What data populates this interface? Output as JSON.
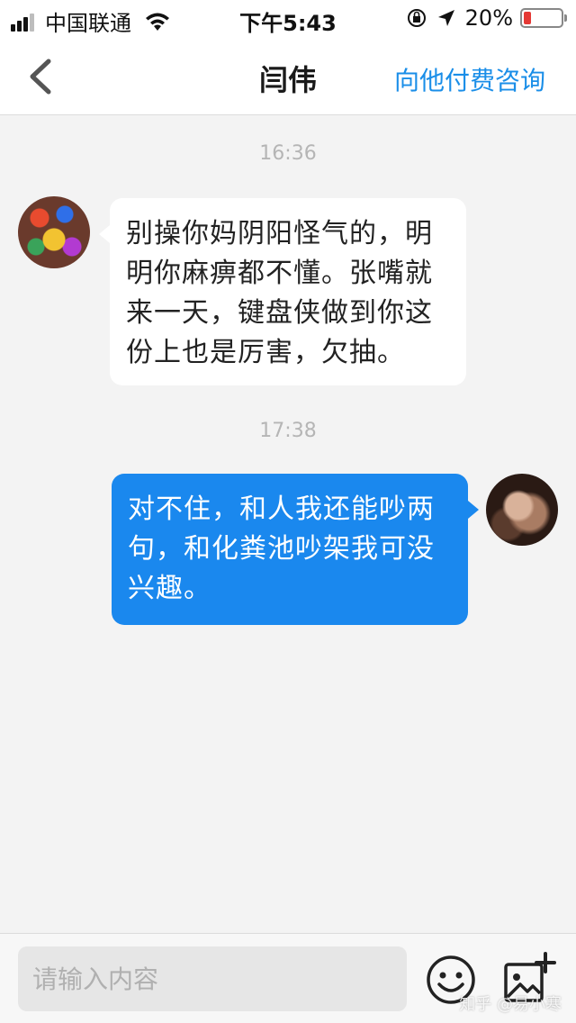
{
  "status_bar": {
    "carrier": "中国联通",
    "time": "下午5:43",
    "battery": "20%",
    "battery_level": 0.2
  },
  "nav": {
    "title": "闫伟",
    "action": "向他付费咨询"
  },
  "messages": [
    {
      "time": "16:36",
      "side": "left",
      "text": "别操你妈阴阳怪气的，明明你麻痹都不懂。张嘴就来一天，键盘侠做到你这份上也是厉害，欠抽。"
    },
    {
      "time": "17:38",
      "side": "right",
      "text": "对不住，和人我还能吵两句，和化粪池吵架我可没兴趣。"
    }
  ],
  "input": {
    "placeholder": "请输入内容"
  },
  "watermark": "知乎 @易小寒",
  "colors": {
    "accent": "#1a88ee",
    "battery_low": "#e53935"
  },
  "icons": [
    "signal-icon",
    "wifi-icon",
    "orientation-lock-icon",
    "location-arrow-icon",
    "battery-icon",
    "back-chevron-icon",
    "emoji-icon",
    "image-add-icon"
  ]
}
